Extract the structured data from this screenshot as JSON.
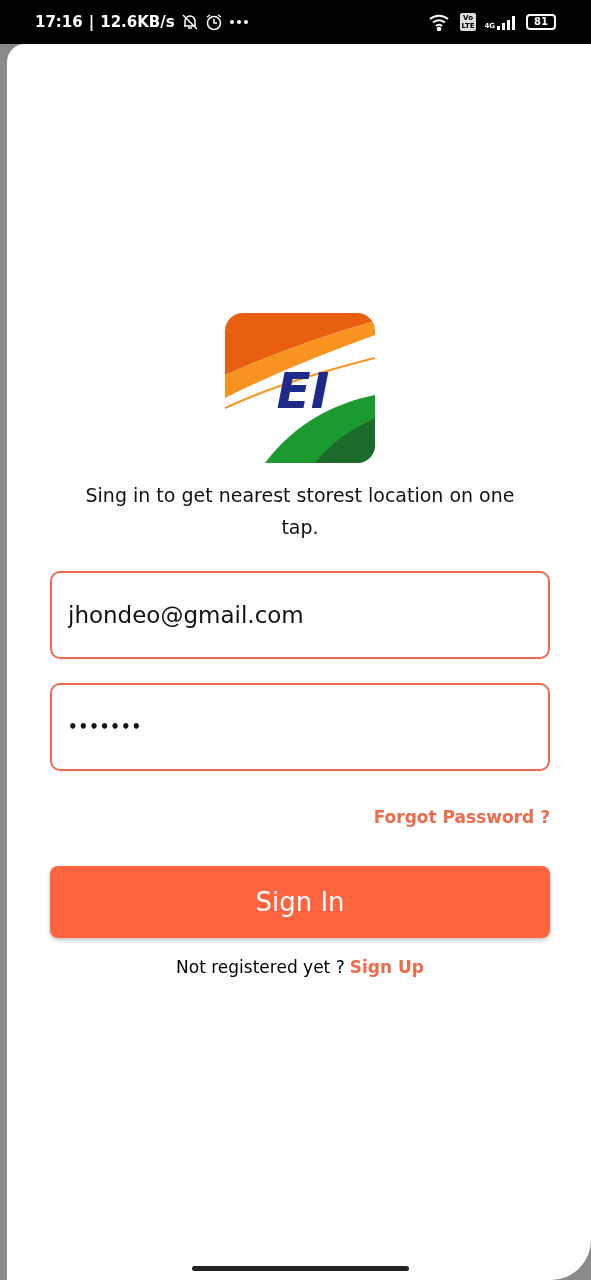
{
  "status_bar": {
    "time": "17:16",
    "separator": "|",
    "speed": "12.6KB/s",
    "volte_top": "Vo",
    "volte_bottom": "LTE",
    "network": "4G",
    "battery": "81"
  },
  "logo": {
    "text": "EI"
  },
  "tagline": "Sing in to get nearest storest location on one tap.",
  "fields": [
    {
      "kind": "email",
      "value": "jhondeo@gmail.com"
    },
    {
      "kind": "password",
      "value": "•••••••"
    }
  ],
  "forgot_link": "Forgot Password ?",
  "sign_in_button": "Sign In",
  "signup_prompt": {
    "text": "Not registered yet ?",
    "link": "Sign Up"
  }
}
